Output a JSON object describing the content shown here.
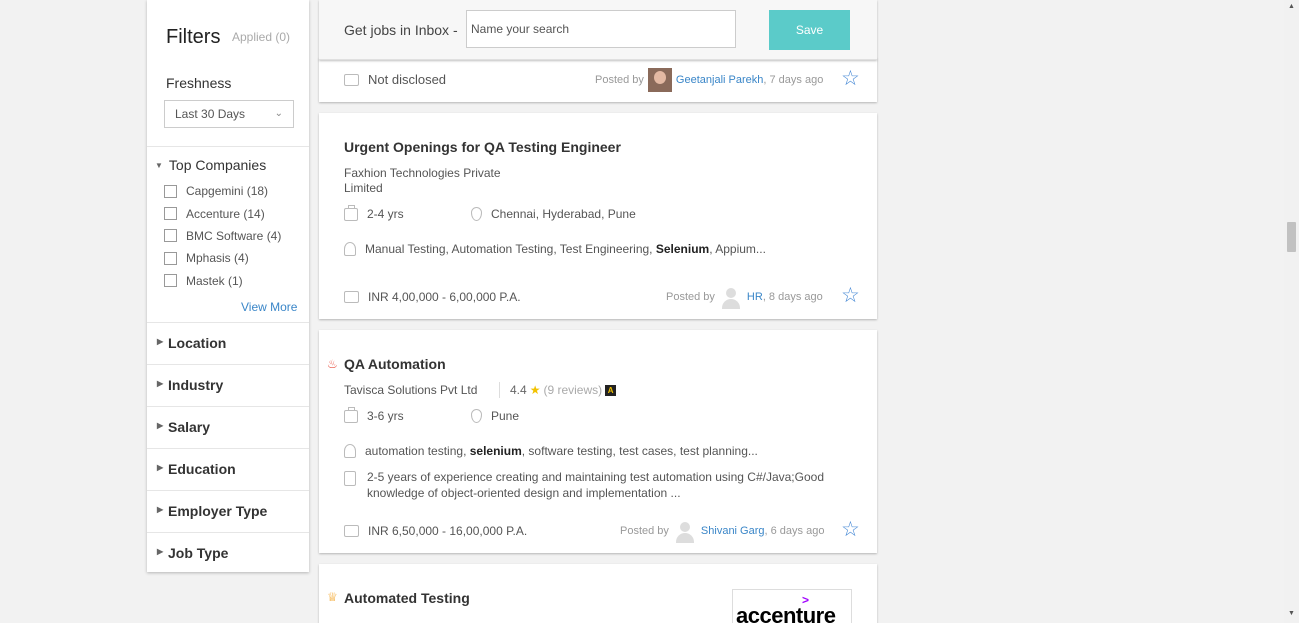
{
  "sidebar": {
    "title": "Filters",
    "applied": "Applied (0)",
    "freshness": {
      "label": "Freshness",
      "selected": "Last 30 Days"
    },
    "top_companies": {
      "label": "Top Companies",
      "items": [
        {
          "label": "Capgemini (18)"
        },
        {
          "label": "Accenture (14)"
        },
        {
          "label": "BMC Software (4)"
        },
        {
          "label": "Mphasis (4)"
        },
        {
          "label": "Mastek (1)"
        }
      ],
      "view_more": "View More"
    },
    "facets": [
      {
        "label": "Location"
      },
      {
        "label": "Industry"
      },
      {
        "label": "Salary"
      },
      {
        "label": "Education"
      },
      {
        "label": "Employer Type"
      },
      {
        "label": "Job Type"
      }
    ]
  },
  "inbox": {
    "label": "Get jobs in Inbox -",
    "placeholder": "Name your search",
    "save_label": "Save"
  },
  "jobs": [
    {
      "salary": "Not disclosed",
      "posted_by_label": "Posted by",
      "poster": "Geetanjali Parekh",
      "age": ", 7 days ago"
    },
    {
      "title": "Urgent Openings for QA Testing Engineer",
      "company": "Faxhion Technologies Private Limited",
      "experience": "2-4 yrs",
      "location": "Chennai, Hyderabad, Pune",
      "skills_pre": "Manual Testing, Automation Testing, Test Engineering, ",
      "skills_bold": "Selenium",
      "skills_post": ", Appium...",
      "salary": "INR 4,00,000 - 6,00,000 P.A.",
      "posted_by_label": "Posted by",
      "poster": "HR",
      "age": ", 8 days ago"
    },
    {
      "title": "QA Automation",
      "company": "Tavisca Solutions Pvt Ltd",
      "rating": "4.4",
      "reviews": "(9 reviews)",
      "experience": "3-6 yrs",
      "location": "Pune",
      "skills_pre": "automation testing, ",
      "skills_bold": "selenium",
      "skills_post": ", software testing, test cases, test planning...",
      "description": "2-5 years of experience creating and maintaining test automation using C#/Java;Good knowledge of object-oriented design and implementation ...",
      "salary": "INR 6,50,000 - 16,00,000 P.A.",
      "posted_by_label": "Posted by",
      "poster": "Shivani Garg",
      "age": ", 6 days ago"
    },
    {
      "title": "Automated Testing",
      "logo_text": "accenture"
    }
  ],
  "colors": {
    "accent": "#5bcbc9",
    "link": "#3a86c8",
    "star": "#4a8bd6"
  }
}
